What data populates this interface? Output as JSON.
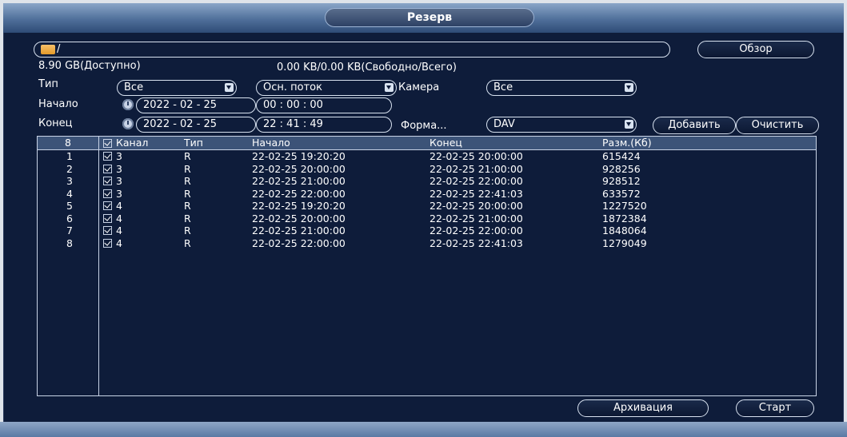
{
  "title": "Резерв",
  "path": {
    "value": "/"
  },
  "storage": {
    "available": "8.90 GB(Доступно)",
    "free_total": "0.00 KB/0.00 KB(Свободно/Всего)"
  },
  "buttons": {
    "browse": "Обзор",
    "add": "Добавить",
    "clear": "Очистить",
    "archive": "Архивация",
    "start": "Старт"
  },
  "filters": {
    "type_label": "Тип",
    "type_value": "Все",
    "stream_value": "Осн. поток",
    "camera_label": "Камера",
    "camera_value": "Все",
    "start_label": "Начало",
    "start_date": "2022 - 02 - 25",
    "start_time": "00 : 00 : 00",
    "end_label": "Конец",
    "end_date": "2022 - 02 - 25",
    "end_time": "22 : 41 : 49",
    "format_label": "Форма...",
    "format_value": "DAV"
  },
  "table": {
    "headers": [
      "8",
      "Канал",
      "Тип",
      "Начало",
      "Конец",
      "Разм.(Кб)"
    ],
    "rows": [
      {
        "n": "1",
        "channel": "3",
        "type": "R",
        "start": "22-02-25 19:20:20",
        "end": "22-02-25 20:00:00",
        "size": "615424"
      },
      {
        "n": "2",
        "channel": "3",
        "type": "R",
        "start": "22-02-25 20:00:00",
        "end": "22-02-25 21:00:00",
        "size": "928256"
      },
      {
        "n": "3",
        "channel": "3",
        "type": "R",
        "start": "22-02-25 21:00:00",
        "end": "22-02-25 22:00:00",
        "size": "928512"
      },
      {
        "n": "4",
        "channel": "3",
        "type": "R",
        "start": "22-02-25 22:00:00",
        "end": "22-02-25 22:41:03",
        "size": "633572"
      },
      {
        "n": "5",
        "channel": "4",
        "type": "R",
        "start": "22-02-25 19:20:20",
        "end": "22-02-25 20:00:00",
        "size": "1227520"
      },
      {
        "n": "6",
        "channel": "4",
        "type": "R",
        "start": "22-02-25 20:00:00",
        "end": "22-02-25 21:00:00",
        "size": "1872384"
      },
      {
        "n": "7",
        "channel": "4",
        "type": "R",
        "start": "22-02-25 21:00:00",
        "end": "22-02-25 22:00:00",
        "size": "1848064"
      },
      {
        "n": "8",
        "channel": "4",
        "type": "R",
        "start": "22-02-25 22:00:00",
        "end": "22-02-25 22:41:03",
        "size": "1279049"
      }
    ]
  },
  "colors": {
    "background": "#0e1c3a",
    "header_row": "#3c5378",
    "border": "#d8e2f0"
  }
}
